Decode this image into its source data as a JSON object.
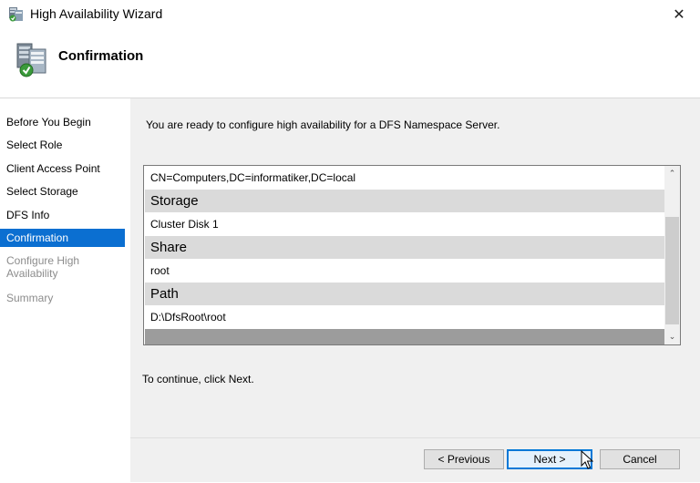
{
  "window": {
    "title": "High Availability Wizard",
    "close_symbol": "✕"
  },
  "header": {
    "title": "Confirmation",
    "icon": "wizard-server-icon"
  },
  "nav": {
    "items": [
      {
        "label": "Before You Begin",
        "state": "normal"
      },
      {
        "label": "Select Role",
        "state": "normal"
      },
      {
        "label": "Client Access Point",
        "state": "normal"
      },
      {
        "label": "Select Storage",
        "state": "normal"
      },
      {
        "label": "DFS Info",
        "state": "normal"
      },
      {
        "label": "Confirmation",
        "state": "active"
      },
      {
        "label": "Configure High Availability",
        "state": "disabled"
      },
      {
        "label": "Summary",
        "state": "disabled"
      }
    ]
  },
  "main": {
    "intro": "You are ready to configure high availability for a DFS Namespace Server.",
    "list": {
      "rows": [
        {
          "type": "value",
          "text": "CN=Computers,DC=informatiker,DC=local"
        },
        {
          "type": "head",
          "text": "Storage"
        },
        {
          "type": "value",
          "text": "Cluster Disk 1"
        },
        {
          "type": "head",
          "text": "Share"
        },
        {
          "type": "value",
          "text": "root"
        },
        {
          "type": "head",
          "text": "Path"
        },
        {
          "type": "value",
          "text": "D:\\DfsRoot\\root"
        }
      ],
      "scroll_up": "⌃",
      "scroll_down": "⌄"
    },
    "continue_text": "To continue, click Next."
  },
  "buttons": {
    "previous": "< Previous",
    "next": "Next >",
    "cancel": "Cancel"
  },
  "colors": {
    "accent": "#0b6fd1",
    "focus_border": "#0078d7"
  }
}
